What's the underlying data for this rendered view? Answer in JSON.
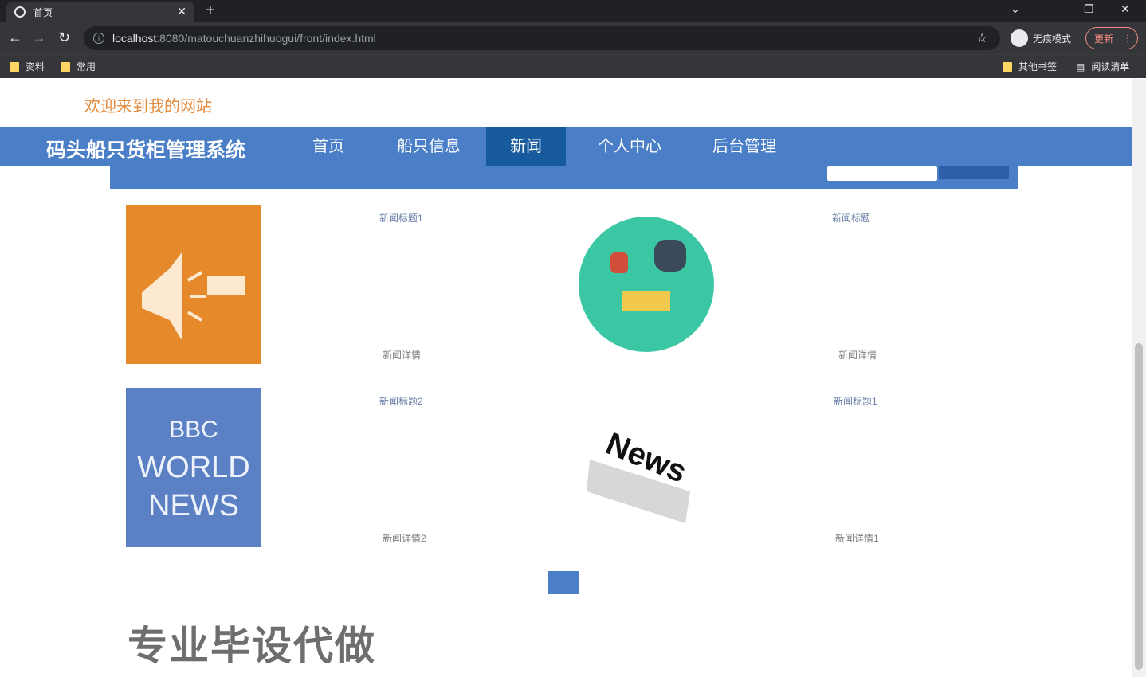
{
  "browser": {
    "tab_title": "首页",
    "url_host": "localhost",
    "url_rest": ":8080/matouchuanzhihuogui/front/index.html",
    "incognito_label": "无痕模式",
    "update_label": "更新",
    "bookmarks": [
      "资料",
      "常用"
    ],
    "other_bookmarks": "其他书签",
    "reading_list": "阅读清单"
  },
  "site": {
    "welcome": "欢迎来到我的网站",
    "brand": "码头船只货柜管理系统",
    "nav": [
      "首页",
      "船只信息",
      "新闻",
      "个人中心",
      "后台管理"
    ],
    "active_nav": "新闻"
  },
  "news": [
    {
      "title": "新闻标题1",
      "detail": "新闻详情",
      "thumb": "megaphone-image",
      "thumb_color": "#e5892a"
    },
    {
      "title": "新闻标题",
      "detail": "新闻详情",
      "thumb": "news-circle-image",
      "thumb_color": "#3cc7a4"
    },
    {
      "title": "新闻标题2",
      "detail": "新闻详情2",
      "thumb": "world-news-image",
      "thumb_color": "#5b80c4"
    },
    {
      "title": "新闻标题1",
      "detail": "新闻详情1",
      "thumb": "news-paper-image",
      "thumb_color": "#dddddd"
    }
  ],
  "watermark": "专业毕设代做",
  "colors": {
    "nav": "#4a7ec6",
    "active": "#175a9d",
    "welcome": "#e5893a"
  }
}
